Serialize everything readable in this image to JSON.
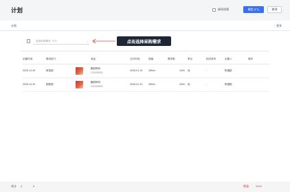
{
  "header": {
    "title": "计划",
    "continue_label": "继续创建",
    "ok_label": "确定 (F1)",
    "cancel_label": "取消"
  },
  "subbar": {
    "tab_label": "计划",
    "more_label": "⋮ 更多"
  },
  "selector": {
    "placeholder": "选择采购需求（F5）",
    "arrow": "⌄"
  },
  "callout": {
    "text": "点击选择采购需求"
  },
  "table": {
    "columns": [
      "创建时间",
      "需求部门",
      "",
      "商品",
      "交付时间",
      "规格",
      "需求数",
      "单位",
      "相关单号",
      "创建人",
      "操作"
    ],
    "rows": [
      {
        "created": "2025-12-30",
        "department": "研发部",
        "product_name": "鹏跃陈科",
        "product_code": "CG120003",
        "delivery": "2026-01-15",
        "spec": "280ml",
        "quantity": "1000",
        "unit": "包",
        "related": "-",
        "creator": "陈遵航",
        "action": ""
      },
      {
        "created": "2025-12-30",
        "department": "销售部",
        "product_name": "鹏跃陈科",
        "product_code": "CG120003",
        "delivery": "2026-01-31",
        "spec": "280ml",
        "quantity": "2000",
        "unit": "包",
        "related": "-",
        "creator": "陈遵航",
        "action": ""
      }
    ]
  },
  "footer": {
    "total_label": "合计",
    "total_count": "2",
    "total_zero": "0",
    "qty_label": "数量:",
    "qty_value": "3000"
  },
  "colors": {
    "primary": "#3b6ff2",
    "callout_bg": "#1f2737",
    "accent_red": "#e0463a"
  }
}
